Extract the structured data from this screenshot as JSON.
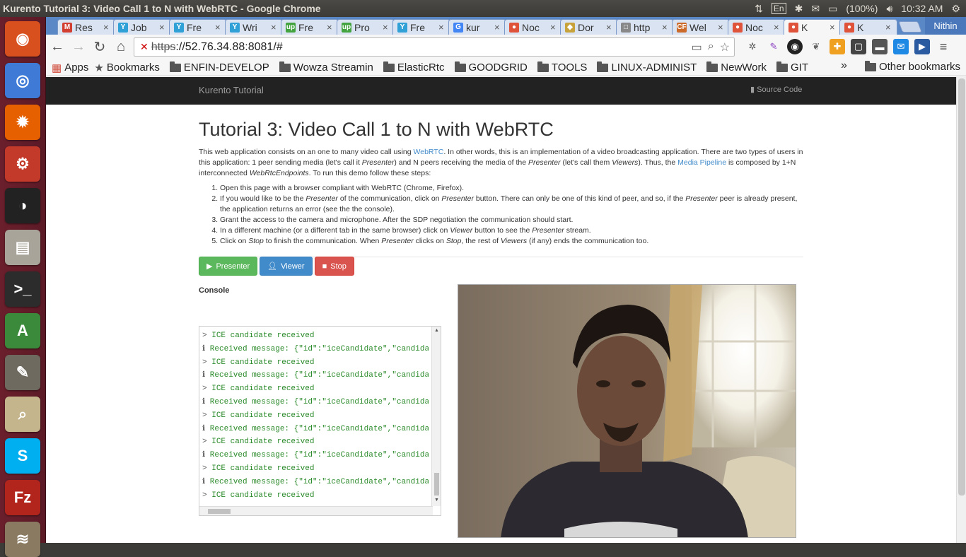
{
  "window_title": "Kurento Tutorial 3: Video Call 1 to N with WebRTC - Google Chrome",
  "panel": {
    "keyboard": "En",
    "battery": "(100%)",
    "clock": "10:32 AM"
  },
  "launcher": [
    {
      "name": "ubuntu-dash",
      "color": "#d9501f",
      "glyph": "◉"
    },
    {
      "name": "chrome",
      "color": "#3f7bd6",
      "glyph": "◎"
    },
    {
      "name": "firefox",
      "color": "#e66000",
      "glyph": "✹"
    },
    {
      "name": "system-settings",
      "color": "#c43a2a",
      "glyph": "⚙"
    },
    {
      "name": "inkscape",
      "color": "#222222",
      "glyph": "◑"
    },
    {
      "name": "files",
      "color": "#a9a49a",
      "glyph": "▤"
    },
    {
      "name": "terminal",
      "color": "#2c2c2c",
      "glyph": ">_"
    },
    {
      "name": "software-center",
      "color": "#3b8a3b",
      "glyph": "A"
    },
    {
      "name": "gimp",
      "color": "#6f6a5f",
      "glyph": "✎"
    },
    {
      "name": "image-viewer",
      "color": "#c4b58c",
      "glyph": "⌕"
    },
    {
      "name": "skype",
      "color": "#00aff0",
      "glyph": "S"
    },
    {
      "name": "filezilla",
      "color": "#b1251c",
      "glyph": "Fz"
    },
    {
      "name": "stack-app",
      "color": "#8b7a62",
      "glyph": "≋"
    }
  ],
  "tabs": [
    {
      "label": "Res",
      "fav_color": "#d23f31",
      "fav": "M"
    },
    {
      "label": "Job",
      "fav_color": "#2fa1d6",
      "fav": "Y"
    },
    {
      "label": "Fre",
      "fav_color": "#2fa1d6",
      "fav": "Y"
    },
    {
      "label": "Wri",
      "fav_color": "#2fa1d6",
      "fav": "Y"
    },
    {
      "label": "Fre",
      "fav_color": "#43a33e",
      "fav": "up"
    },
    {
      "label": "Pro",
      "fav_color": "#43a33e",
      "fav": "up"
    },
    {
      "label": "Fre",
      "fav_color": "#2fa1d6",
      "fav": "Y"
    },
    {
      "label": "kur",
      "fav_color": "#4285f4",
      "fav": "G"
    },
    {
      "label": "Noc",
      "fav_color": "#e0533b",
      "fav": "●"
    },
    {
      "label": "Dor",
      "fav_color": "#c8a23a",
      "fav": "◆"
    },
    {
      "label": "http",
      "fav_color": "#888888",
      "fav": "□"
    },
    {
      "label": "Wel",
      "fav_color": "#cc6a2a",
      "fav": "CF"
    },
    {
      "label": "Noc",
      "fav_color": "#e0533b",
      "fav": "●"
    },
    {
      "label": "K",
      "fav_color": "#e0533b",
      "fav": "●",
      "active": true
    },
    {
      "label": "K",
      "fav_color": "#e0533b",
      "fav": "●"
    }
  ],
  "profile_name": "Nithin",
  "address": {
    "scheme": "https",
    "rest": "://52.76.34.88:8081/#"
  },
  "bookmarks": {
    "apps": "Apps",
    "bookmarks": "Bookmarks",
    "folders": [
      "ENFIN-DEVELOP",
      "Wowza Streamin",
      "ElasticRtc",
      "GOODGRID",
      "TOOLS",
      "LINUX-ADMINIST",
      "NewWork",
      "GIT"
    ],
    "other": "Other bookmarks",
    "overflow": "»"
  },
  "page": {
    "brand": "Kurento Tutorial",
    "source_code": "Source Code",
    "title": "Tutorial 3: Video Call 1 to N with WebRTC",
    "intro": {
      "p1": "This web application consists on an one to many video call using ",
      "webrtc_link": "WebRTC",
      "p2": ". In other words, this is an implementation of a video broadcasting application. There are two types of users in this application: 1 peer sending media (let's call it ",
      "presenter": "Presenter",
      "p3": ") and N peers receiving the media of the ",
      "p4": " (let's call them ",
      "viewers": "Viewers",
      "p5": "). Thus, the ",
      "pipeline_link": "Media Pipeline",
      "p6": " is composed by 1+N interconnected ",
      "endpoints": "WebRtcEndpoints",
      "p7": ". To run this demo follow these steps:"
    },
    "steps": {
      "s1": "Open this page with a browser compliant with WebRTC (Chrome, Firefox).",
      "s2a": "If you would like to be the ",
      "s2b": " of the communication, click on ",
      "s2c": " button. There can only be one of this kind of peer, and so, if the ",
      "s2d": " peer is already present, the application returns an error (see the the console).",
      "s3": "Grant the access to the camera and microphone. After the SDP negotiation the communication should start.",
      "s4a": "In a different machine (or a different tab in the same browser) click on ",
      "viewer": "Viewer",
      "s4b": " button to see the ",
      "s4c": " stream.",
      "s5a": "Click on ",
      "stop": "Stop",
      "s5b": " to finish the communication. When ",
      "s5c": " clicks on ",
      "s5d": ", the rest of ",
      "s5e": " (if any) ends the communication too."
    },
    "buttons": {
      "presenter": "Presenter",
      "viewer": "Viewer",
      "stop": "Stop"
    },
    "console_label": "Console",
    "console_lines": [
      {
        "mk": ">",
        "tx": "ICE candidate received"
      },
      {
        "mk": "ℹ",
        "tx": "Received message: {\"id\":\"iceCandidate\",\"candidate"
      },
      {
        "mk": ">",
        "tx": "ICE candidate received"
      },
      {
        "mk": "ℹ",
        "tx": "Received message: {\"id\":\"iceCandidate\",\"candidate"
      },
      {
        "mk": ">",
        "tx": "ICE candidate received"
      },
      {
        "mk": "ℹ",
        "tx": "Received message: {\"id\":\"iceCandidate\",\"candidate"
      },
      {
        "mk": ">",
        "tx": "ICE candidate received"
      },
      {
        "mk": "ℹ",
        "tx": "Received message: {\"id\":\"iceCandidate\",\"candidate"
      },
      {
        "mk": ">",
        "tx": "ICE candidate received"
      },
      {
        "mk": "ℹ",
        "tx": "Received message: {\"id\":\"iceCandidate\",\"candidate"
      },
      {
        "mk": ">",
        "tx": "ICE candidate received"
      },
      {
        "mk": "ℹ",
        "tx": "Received message: {\"id\":\"iceCandidate\",\"candidate"
      },
      {
        "mk": ">",
        "tx": "ICE candidate received"
      }
    ]
  }
}
